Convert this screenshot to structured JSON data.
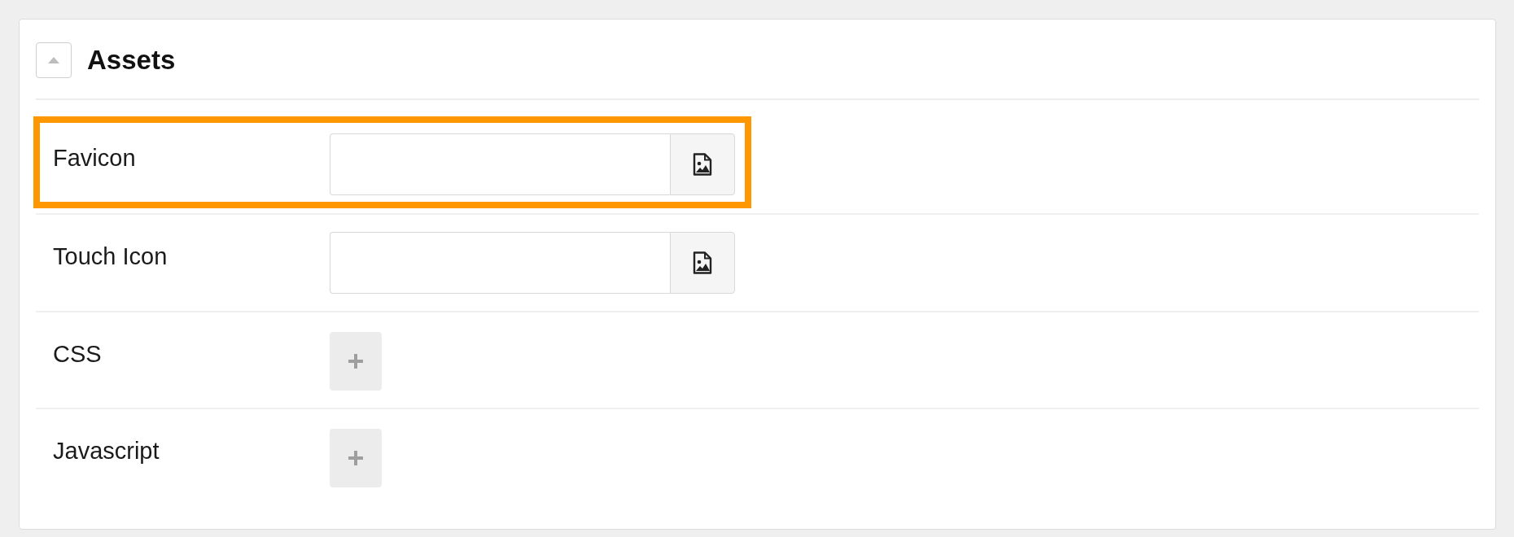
{
  "panel": {
    "title": "Assets",
    "expanded": true
  },
  "rows": [
    {
      "label": "Favicon",
      "kind": "image",
      "highlighted": true
    },
    {
      "label": "Touch Icon",
      "kind": "image",
      "highlighted": false
    },
    {
      "label": "CSS",
      "kind": "add",
      "highlighted": false
    },
    {
      "label": "Javascript",
      "kind": "add",
      "highlighted": false
    }
  ]
}
